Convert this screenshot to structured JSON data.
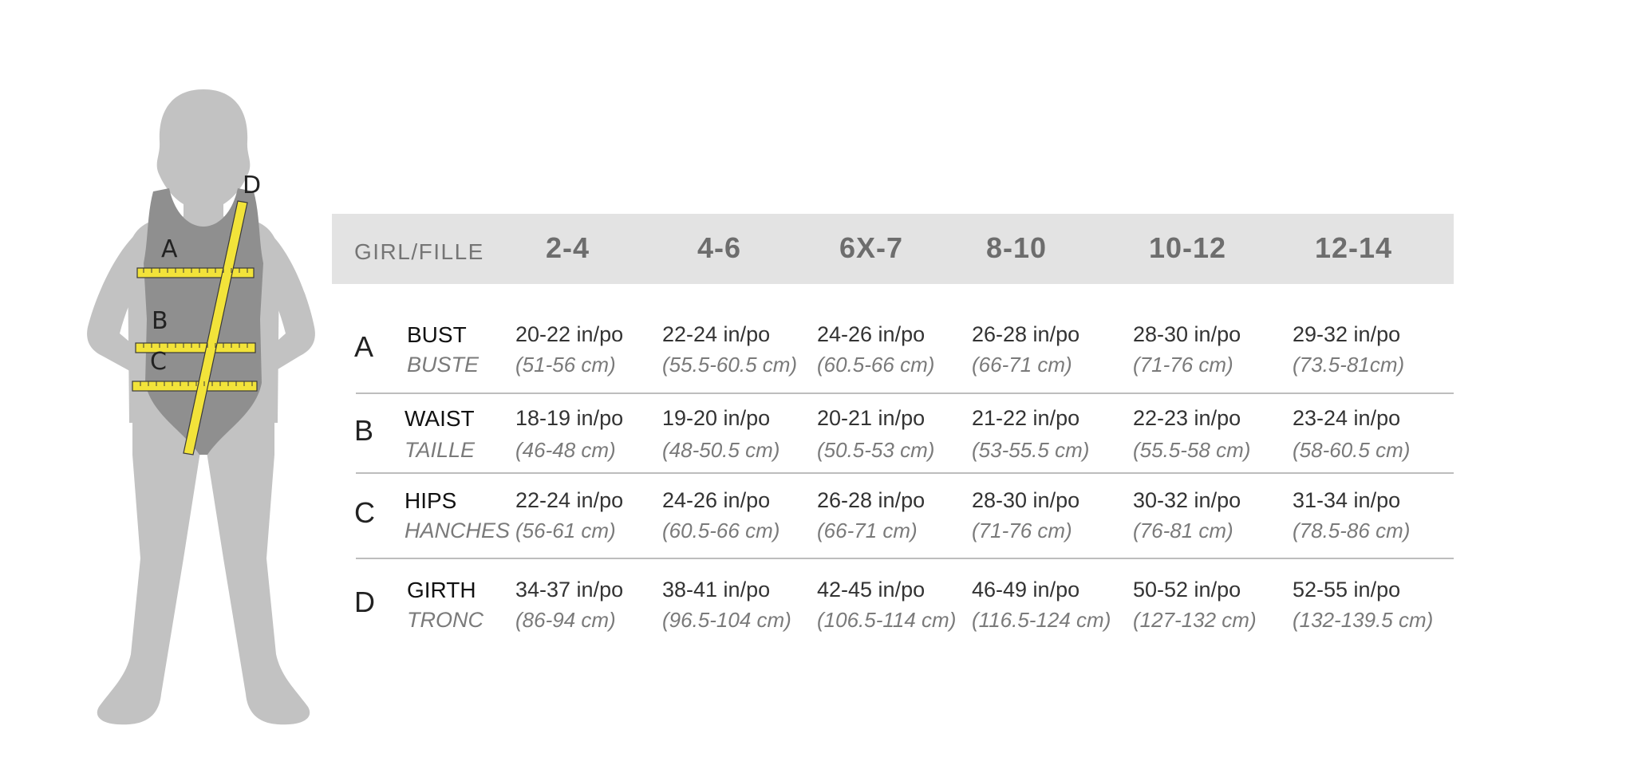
{
  "figure": {
    "labels": [
      "A",
      "B",
      "C",
      "D"
    ]
  },
  "table": {
    "header_label": "GIRL/FILLE",
    "sizes": [
      "2-4",
      "4-6",
      "6X-7",
      "8-10",
      "10-12",
      "12-14"
    ],
    "rows": [
      {
        "key": "A",
        "name_en": "BUST",
        "name_fr": "BUSTE",
        "cells": [
          {
            "in": "20-22 in/po",
            "cm": "(51-56 cm)"
          },
          {
            "in": "22-24 in/po",
            "cm": "(55.5-60.5 cm)"
          },
          {
            "in": "24-26 in/po",
            "cm": "(60.5-66 cm)"
          },
          {
            "in": "26-28 in/po",
            "cm": "(66-71 cm)"
          },
          {
            "in": "28-30 in/po",
            "cm": "(71-76 cm)"
          },
          {
            "in": "29-32 in/po",
            "cm": "(73.5-81cm)"
          }
        ]
      },
      {
        "key": "B",
        "name_en": "WAIST",
        "name_fr": "TAILLE",
        "cells": [
          {
            "in": "18-19 in/po",
            "cm": "(46-48 cm)"
          },
          {
            "in": "19-20 in/po",
            "cm": "(48-50.5 cm)"
          },
          {
            "in": "20-21 in/po",
            "cm": "(50.5-53 cm)"
          },
          {
            "in": "21-22 in/po",
            "cm": "(53-55.5 cm)"
          },
          {
            "in": "22-23 in/po",
            "cm": "(55.5-58 cm)"
          },
          {
            "in": "23-24 in/po",
            "cm": "(58-60.5 cm)"
          }
        ]
      },
      {
        "key": "C",
        "name_en": "HIPS",
        "name_fr": "HANCHES",
        "cells": [
          {
            "in": "22-24 in/po",
            "cm": "(56-61 cm)"
          },
          {
            "in": "24-26 in/po",
            "cm": "(60.5-66 cm)"
          },
          {
            "in": "26-28 in/po",
            "cm": "(66-71 cm)"
          },
          {
            "in": "28-30 in/po",
            "cm": "(71-76 cm)"
          },
          {
            "in": "30-32 in/po",
            "cm": "(76-81 cm)"
          },
          {
            "in": "31-34 in/po",
            "cm": "(78.5-86 cm)"
          }
        ]
      },
      {
        "key": "D",
        "name_en": "GIRTH",
        "name_fr": "TRONC",
        "cells": [
          {
            "in": "34-37 in/po",
            "cm": "(86-94 cm)"
          },
          {
            "in": "38-41 in/po",
            "cm": "(96.5-104 cm)"
          },
          {
            "in": "42-45 in/po",
            "cm": "(106.5-114 cm)"
          },
          {
            "in": "46-49 in/po",
            "cm": "(116.5-124 cm)"
          },
          {
            "in": "50-52 in/po",
            "cm": "(127-132 cm)"
          },
          {
            "in": "52-55 in/po",
            "cm": "(132-139.5 cm)"
          }
        ]
      }
    ]
  },
  "colors": {
    "figure_gray": "#c2c2c2",
    "suit_gray": "#8f8f8f",
    "tape_yellow": "#f2e33a",
    "header_bg": "#e3e3e3"
  }
}
